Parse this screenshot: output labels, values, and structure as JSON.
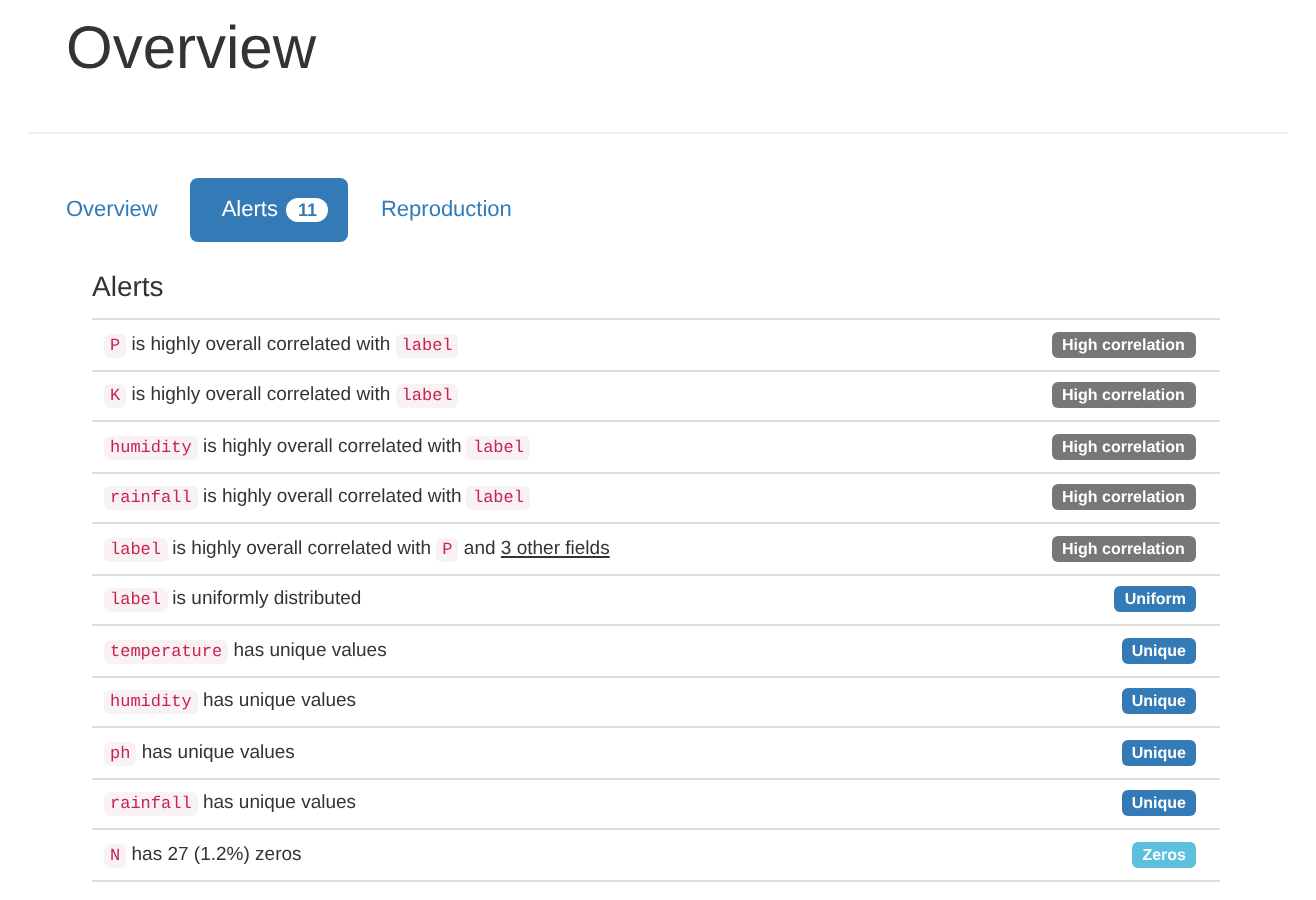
{
  "title": "Overview",
  "tabs": [
    {
      "label": "Overview",
      "selected": false
    },
    {
      "label": "Alerts",
      "count": "11",
      "selected": true
    },
    {
      "label": "Reproduction",
      "selected": false
    }
  ],
  "alerts_heading": "Alerts",
  "alerts": [
    {
      "parts": [
        {
          "kind": "code",
          "text": "P"
        },
        {
          "kind": "text",
          "text": " is highly overall correlated with "
        },
        {
          "kind": "code",
          "text": "label"
        }
      ],
      "badge": {
        "label": "High correlation",
        "kind": "correlation"
      }
    },
    {
      "parts": [
        {
          "kind": "code",
          "text": "K"
        },
        {
          "kind": "text",
          "text": " is highly overall correlated with "
        },
        {
          "kind": "code",
          "text": "label"
        }
      ],
      "badge": {
        "label": "High correlation",
        "kind": "correlation"
      }
    },
    {
      "parts": [
        {
          "kind": "code",
          "text": "humidity"
        },
        {
          "kind": "text",
          "text": " is highly overall correlated with "
        },
        {
          "kind": "code",
          "text": "label"
        }
      ],
      "badge": {
        "label": "High correlation",
        "kind": "correlation"
      }
    },
    {
      "parts": [
        {
          "kind": "code",
          "text": "rainfall"
        },
        {
          "kind": "text",
          "text": " is highly overall correlated with "
        },
        {
          "kind": "code",
          "text": "label"
        }
      ],
      "badge": {
        "label": "High correlation",
        "kind": "correlation"
      }
    },
    {
      "parts": [
        {
          "kind": "code",
          "text": "label"
        },
        {
          "kind": "text",
          "text": " is highly overall correlated with "
        },
        {
          "kind": "code",
          "text": "P"
        },
        {
          "kind": "text",
          "text": " and "
        },
        {
          "kind": "link",
          "text": "3 other fields"
        }
      ],
      "badge": {
        "label": "High correlation",
        "kind": "correlation"
      }
    },
    {
      "parts": [
        {
          "kind": "code",
          "text": "label"
        },
        {
          "kind": "text",
          "text": " is uniformly distributed"
        }
      ],
      "badge": {
        "label": "Uniform",
        "kind": "uniform"
      }
    },
    {
      "parts": [
        {
          "kind": "code",
          "text": "temperature"
        },
        {
          "kind": "text",
          "text": " has unique values"
        }
      ],
      "badge": {
        "label": "Unique",
        "kind": "unique"
      }
    },
    {
      "parts": [
        {
          "kind": "code",
          "text": "humidity"
        },
        {
          "kind": "text",
          "text": " has unique values"
        }
      ],
      "badge": {
        "label": "Unique",
        "kind": "unique"
      }
    },
    {
      "parts": [
        {
          "kind": "code",
          "text": "ph"
        },
        {
          "kind": "text",
          "text": " has unique values"
        }
      ],
      "badge": {
        "label": "Unique",
        "kind": "unique"
      }
    },
    {
      "parts": [
        {
          "kind": "code",
          "text": "rainfall"
        },
        {
          "kind": "text",
          "text": " has unique values"
        }
      ],
      "badge": {
        "label": "Unique",
        "kind": "unique"
      }
    },
    {
      "parts": [
        {
          "kind": "code",
          "text": "N"
        },
        {
          "kind": "text",
          "text": " has 27 (1.2%) zeros"
        }
      ],
      "badge": {
        "label": "Zeros",
        "kind": "zeros"
      }
    }
  ]
}
